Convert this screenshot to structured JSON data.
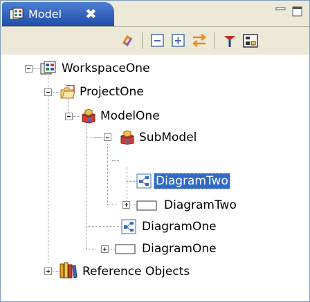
{
  "view": {
    "title": "Model",
    "close_symbol": "✖"
  },
  "toolbar": {
    "icons": [
      "sync-icon",
      "collapse-all-icon",
      "expand-all-icon",
      "link-with-editor-icon",
      "filter-icon",
      "view-menu-icon"
    ]
  },
  "tree": {
    "nodes": [
      {
        "label": "WorkspaceOne",
        "icon": "workspace-icon",
        "toggle": "minus"
      },
      {
        "label": "ProjectOne",
        "icon": "project-folder-icon",
        "toggle": "minus"
      },
      {
        "label": "ModelOne",
        "icon": "model-package-icon",
        "toggle": "minus"
      },
      {
        "label": "SubModel",
        "icon": "model-package-icon",
        "toggle": "minus"
      },
      {
        "label": "DiagramTwo",
        "icon": "diagram-icon",
        "toggle": "none",
        "selected": true
      },
      {
        "label": "DiagramTwo",
        "icon": "diagram-frame-icon",
        "toggle": "plus"
      },
      {
        "label": "DiagramOne",
        "icon": "diagram-icon",
        "toggle": "none"
      },
      {
        "label": "DiagramOne",
        "icon": "diagram-frame-icon",
        "toggle": "plus"
      },
      {
        "label": "Reference Objects",
        "icon": "library-books-icon",
        "toggle": "plus"
      }
    ]
  },
  "colors": {
    "tab_active": "#2a5bbf",
    "selection": "#316ac5",
    "chrome": "#ece9d8"
  }
}
